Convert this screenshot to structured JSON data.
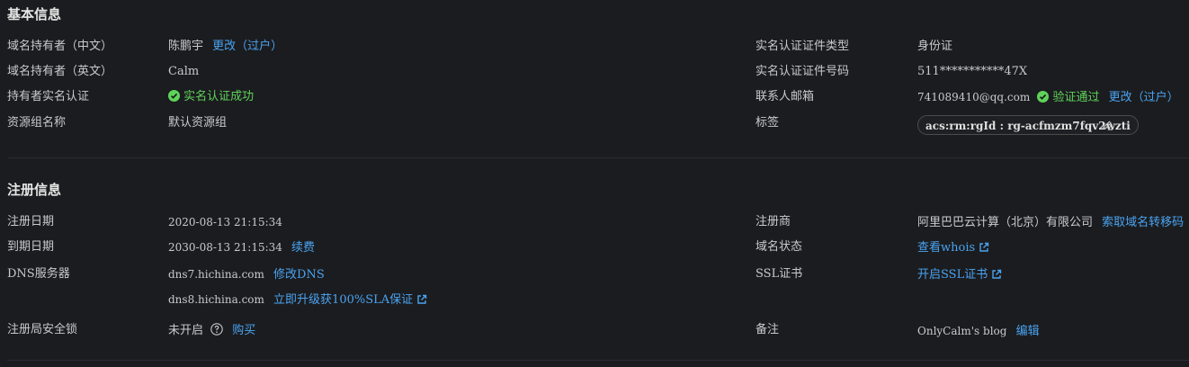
{
  "basic": {
    "title": "基本信息",
    "owner_cn_label": "域名持有者（中文）",
    "owner_cn_value": "陈鹏宇",
    "owner_cn_change": "更改（过户）",
    "owner_en_label": "域名持有者（英文）",
    "owner_en_value": "Calm",
    "realname_label": "持有者实名认证",
    "realname_status": "实名认证成功",
    "rg_label": "资源组名称",
    "rg_value": "默认资源组",
    "cert_type_label": "实名认证证件类型",
    "cert_type_value": "身份证",
    "cert_no_label": "实名认证证件号码",
    "cert_no_value": "511***********47X",
    "email_label": "联系人邮箱",
    "email_value": "741089410@qq.com",
    "email_status": "验证通过",
    "email_change": "更改（过户）",
    "tags_label": "标签",
    "tag_value": "acs:rm:rgId : rg-acfmzm7fqv2wzti"
  },
  "register": {
    "title": "注册信息",
    "reg_date_label": "注册日期",
    "reg_date_value": "2020-08-13 21:15:34",
    "exp_date_label": "到期日期",
    "exp_date_value": "2030-08-13 21:15:34",
    "renew_link": "续费",
    "dns_label": "DNS服务器",
    "dns1": "dns7.hichina.com",
    "dns_modify": "修改DNS",
    "dns2": "dns8.hichina.com",
    "sla_link": "立即升级获100%SLA保证",
    "lock_label": "注册局安全锁",
    "lock_value": "未开启",
    "lock_buy": "购买",
    "registrar_label": "注册商",
    "registrar_value": "阿里巴巴云计算（北京）有限公司",
    "transfer_code": "索取域名转移码",
    "status_label": "域名状态",
    "whois_link": "查看whois",
    "ssl_label": "SSL证书",
    "ssl_link": "开启SSL证书",
    "remark_label": "备注",
    "remark_value": "OnlyCalm's blog",
    "remark_edit": "编辑"
  },
  "colors": {
    "accent": "#4aa3f0",
    "success": "#5fd35a",
    "background": "#1b1c1f"
  }
}
